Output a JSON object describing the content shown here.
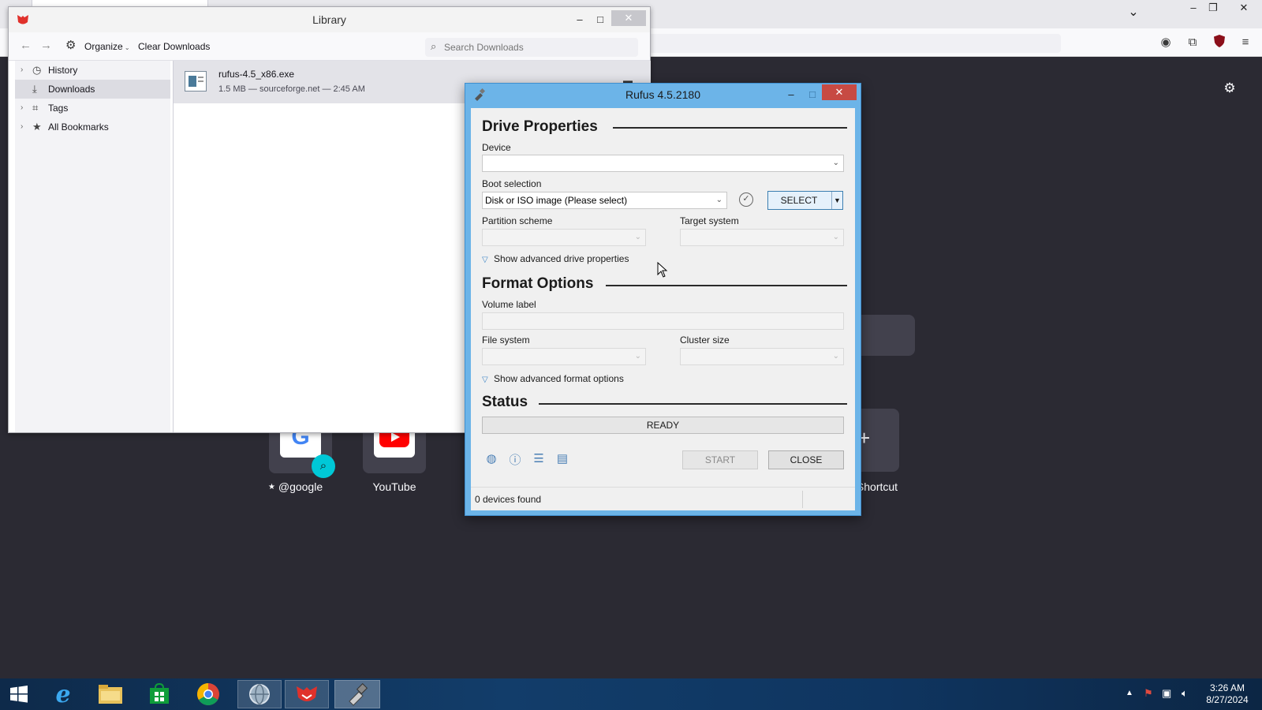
{
  "browser": {
    "tiles": [
      {
        "label": "@google"
      },
      {
        "label": "YouTube"
      },
      {
        "label": "Shortcut"
      }
    ]
  },
  "library": {
    "title": "Library",
    "toolbar": {
      "organize_label": "Organize",
      "clear_label": "Clear Downloads",
      "search_placeholder": "Search Downloads"
    },
    "sidebar": [
      {
        "label": "History"
      },
      {
        "label": "Downloads"
      },
      {
        "label": "Tags"
      },
      {
        "label": "All Bookmarks"
      }
    ],
    "download": {
      "filename": "rufus-4.5_x86.exe",
      "details": "1.5 MB — sourceforge.net — 2:45 AM"
    }
  },
  "rufus": {
    "title": "Rufus 4.5.2180",
    "drive_properties": {
      "heading": "Drive Properties",
      "device_label": "Device",
      "device_value": "",
      "boot_label": "Boot selection",
      "boot_value": "Disk or ISO image (Please select)",
      "select_label": "SELECT",
      "partition_label": "Partition scheme",
      "target_label": "Target system",
      "advanced_label": "Show advanced drive properties"
    },
    "format_options": {
      "heading": "Format Options",
      "volume_label": "Volume label",
      "volume_value": "",
      "filesystem_label": "File system",
      "cluster_label": "Cluster size",
      "advanced_label": "Show advanced format options"
    },
    "status": {
      "heading": "Status",
      "progress_text": "READY",
      "start_label": "START",
      "close_label": "CLOSE",
      "footer_text": "0 devices found"
    }
  },
  "taskbar": {
    "time": "3:26 AM",
    "date": "8/27/2024"
  },
  "colors": {
    "rufus_frame": "#6cb4e8",
    "taskbar": "#123d6a",
    "browser_bg": "#2b2a33"
  }
}
